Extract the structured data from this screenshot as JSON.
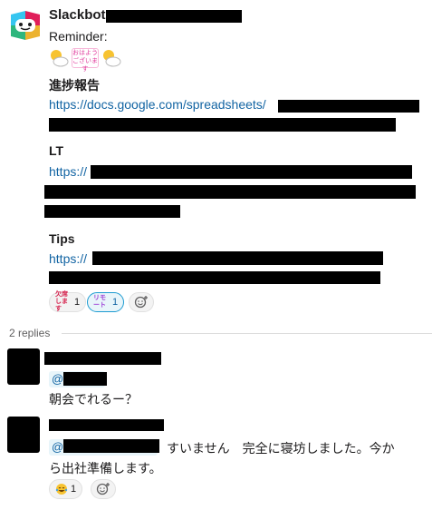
{
  "message": {
    "sender": "Slackbot",
    "reminder_label": "Reminder:",
    "sections": [
      {
        "heading": "進捗報告",
        "link_prefix": "https://docs.google.com/spreadsheets/"
      },
      {
        "heading": "LT",
        "link_prefix": "https://"
      },
      {
        "heading": "Tips",
        "link_prefix": "https://"
      }
    ],
    "greeting_sticker_text": "おはようございます",
    "reactions": [
      {
        "label": "欠席します",
        "count": "1"
      },
      {
        "label": "リモート",
        "count": "1"
      }
    ],
    "add_reaction_icon": "add-emoji-icon"
  },
  "thread": {
    "replies_label": "2 replies",
    "replies": [
      {
        "mention_prefix": "@",
        "text": "朝会でれるー？"
      },
      {
        "mention_prefix": "@",
        "text_line1": "すいません　完全に寝坊しました。今か",
        "text_line2": "ら出社準備します。",
        "reaction_count": "1"
      }
    ]
  },
  "colors": {
    "link": "#1264a3",
    "redaction": "#000000",
    "mention_bg": "#e8f5fa"
  }
}
